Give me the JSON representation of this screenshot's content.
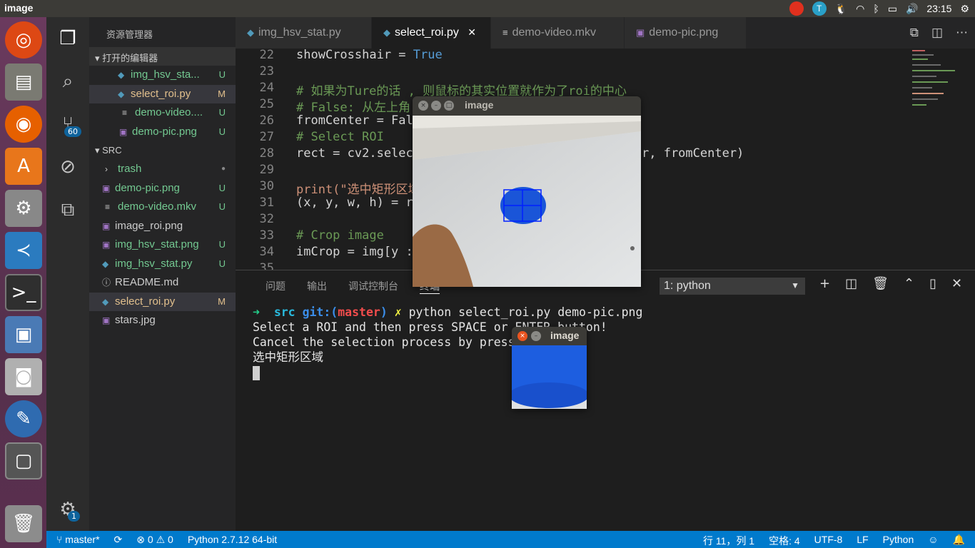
{
  "topbar": {
    "app_title": "image",
    "time": "23:15",
    "tray_icons": [
      "record-icon",
      "toolbox-icon",
      "linux-icon",
      "wifi-icon",
      "bluetooth-icon",
      "battery-icon",
      "volume-icon",
      "settings-gear-icon"
    ]
  },
  "launcher": {
    "items": [
      "ubuntu-dash-icon",
      "files-icon",
      "firefox-icon",
      "software-center-icon",
      "system-settings-icon",
      "vscode-icon",
      "terminal-icon",
      "screen-capture-icon",
      "camera-icon",
      "pencil-app-icon",
      "workspace-icon",
      "trash-icon"
    ]
  },
  "activity": {
    "scm_badge": "60",
    "settings_badge": "1"
  },
  "sidebar": {
    "title": "资源管理器",
    "open_editors_label": "打开的编辑器",
    "open_editors": [
      {
        "name": "img_hsv_sta...",
        "status": "U",
        "icon": "python-file-icon"
      },
      {
        "name": "select_roi.py",
        "status": "M",
        "icon": "python-file-icon"
      },
      {
        "name": "demo-video....",
        "status": "U",
        "icon": "text-file-icon"
      },
      {
        "name": "demo-pic.png",
        "status": "U",
        "icon": "image-file-icon"
      }
    ],
    "src_label": "SRC",
    "files": [
      {
        "name": "trash",
        "status": "●",
        "icon": "folder-chevron-icon"
      },
      {
        "name": "demo-pic.png",
        "status": "U",
        "icon": "image-file-icon"
      },
      {
        "name": "demo-video.mkv",
        "status": "U",
        "icon": "text-file-icon"
      },
      {
        "name": "image_roi.png",
        "status": "",
        "icon": "image-file-icon"
      },
      {
        "name": "img_hsv_stat.png",
        "status": "U",
        "icon": "image-file-icon"
      },
      {
        "name": "img_hsv_stat.py",
        "status": "U",
        "icon": "python-file-icon"
      },
      {
        "name": "README.md",
        "status": "",
        "icon": "info-icon"
      },
      {
        "name": "select_roi.py",
        "status": "M",
        "icon": "python-file-icon"
      },
      {
        "name": "stars.jpg",
        "status": "",
        "icon": "image-file-icon"
      }
    ]
  },
  "tabs": [
    {
      "label": "img_hsv_stat.py"
    },
    {
      "label": "select_roi.py",
      "close": "✕"
    },
    {
      "label": "demo-video.mkv"
    },
    {
      "label": "demo-pic.png"
    }
  ],
  "code": {
    "lines": [
      {
        "n": "22",
        "text": "showCrosshair = True"
      },
      {
        "n": "23",
        "text": ""
      },
      {
        "n": "24",
        "text": "# 如果为Ture的话 , 则鼠标的其实位置就作为了roi的中心"
      },
      {
        "n": "25",
        "text": "# False: 从左上角"
      },
      {
        "n": "26",
        "text": "fromCenter = Fal"
      },
      {
        "n": "27",
        "text": "# Select ROI"
      },
      {
        "n": "28",
        "text": "rect = cv2.selec"
      },
      {
        "n": "29",
        "text": ""
      },
      {
        "n": "30",
        "text": "print(\"选中矩形区域"
      },
      {
        "n": "31",
        "text": "(x, y, w, h) = r"
      },
      {
        "n": "32",
        "text": ""
      },
      {
        "n": "33",
        "text": "# Crop image"
      },
      {
        "n": "34",
        "text": "imCrop = img[y :"
      },
      {
        "n": "35",
        "text": ""
      }
    ],
    "line28_tail": "r, fromCenter)"
  },
  "panel": {
    "tabs": [
      "问题",
      "输出",
      "调试控制台",
      "终端"
    ],
    "terminal_select": "1: python",
    "terminal_lines": [
      {
        "arrow": "➜",
        "dir": "src",
        "git": "git:(",
        "branch": "master",
        "git_end": ")",
        "x": "✗",
        "cmd": "python select_roi.py demo-pic.png"
      },
      {
        "text": "Select a ROI and then press SPACE or ENTER button!"
      },
      {
        "text": "Cancel the selection process by press c button!"
      },
      {
        "text": "选中矩形区域"
      }
    ]
  },
  "window_main": {
    "title": "image"
  },
  "window_roi": {
    "title": "image"
  },
  "statusbar": {
    "branch": "master*",
    "sync": "⟳",
    "errors": "0",
    "warnings": "0",
    "python": "Python 2.7.12 64-bit",
    "position": "行 11，列 1",
    "spaces": "空格: 4",
    "encoding": "UTF-8",
    "eol": "LF",
    "language": "Python"
  }
}
